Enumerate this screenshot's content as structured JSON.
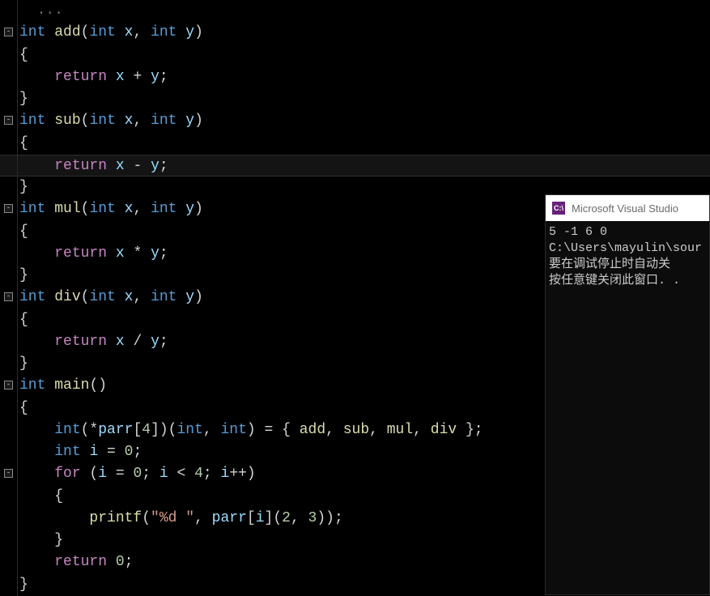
{
  "code_lines": [
    {
      "fold": "",
      "segs": [
        {
          "t": "dim",
          "v": "  ..."
        }
      ]
    },
    {
      "fold": "-",
      "segs": [
        {
          "t": "kw",
          "v": "int"
        },
        {
          "t": "pun",
          "v": " "
        },
        {
          "t": "fn",
          "v": "add"
        },
        {
          "t": "pun",
          "v": "("
        },
        {
          "t": "kw",
          "v": "int"
        },
        {
          "t": "pun",
          "v": " "
        },
        {
          "t": "var",
          "v": "x"
        },
        {
          "t": "pun",
          "v": ", "
        },
        {
          "t": "kw",
          "v": "int"
        },
        {
          "t": "pun",
          "v": " "
        },
        {
          "t": "var",
          "v": "y"
        },
        {
          "t": "pun",
          "v": ")"
        }
      ]
    },
    {
      "fold": "",
      "segs": [
        {
          "t": "pun",
          "v": "{"
        }
      ]
    },
    {
      "fold": "",
      "segs": [
        {
          "t": "pun",
          "v": "    "
        },
        {
          "t": "op",
          "v": "return"
        },
        {
          "t": "pun",
          "v": " "
        },
        {
          "t": "var",
          "v": "x"
        },
        {
          "t": "pun",
          "v": " + "
        },
        {
          "t": "var",
          "v": "y"
        },
        {
          "t": "pun",
          "v": ";"
        }
      ]
    },
    {
      "fold": "",
      "segs": [
        {
          "t": "pun",
          "v": "}"
        }
      ]
    },
    {
      "fold": "-",
      "segs": [
        {
          "t": "kw",
          "v": "int"
        },
        {
          "t": "pun",
          "v": " "
        },
        {
          "t": "fn",
          "v": "sub"
        },
        {
          "t": "pun",
          "v": "("
        },
        {
          "t": "kw",
          "v": "int"
        },
        {
          "t": "pun",
          "v": " "
        },
        {
          "t": "var",
          "v": "x"
        },
        {
          "t": "pun",
          "v": ", "
        },
        {
          "t": "kw",
          "v": "int"
        },
        {
          "t": "pun",
          "v": " "
        },
        {
          "t": "var",
          "v": "y"
        },
        {
          "t": "pun",
          "v": ")"
        }
      ]
    },
    {
      "fold": "",
      "segs": [
        {
          "t": "pun",
          "v": "{"
        }
      ]
    },
    {
      "fold": "",
      "highlight": true,
      "segs": [
        {
          "t": "pun",
          "v": "    "
        },
        {
          "t": "op",
          "v": "return"
        },
        {
          "t": "pun",
          "v": " "
        },
        {
          "t": "var",
          "v": "x"
        },
        {
          "t": "pun",
          "v": " - "
        },
        {
          "t": "var",
          "v": "y"
        },
        {
          "t": "pun",
          "v": ";"
        }
      ]
    },
    {
      "fold": "",
      "segs": [
        {
          "t": "pun",
          "v": "}"
        }
      ]
    },
    {
      "fold": "-",
      "segs": [
        {
          "t": "kw",
          "v": "int"
        },
        {
          "t": "pun",
          "v": " "
        },
        {
          "t": "fn",
          "v": "mul"
        },
        {
          "t": "pun",
          "v": "("
        },
        {
          "t": "kw",
          "v": "int"
        },
        {
          "t": "pun",
          "v": " "
        },
        {
          "t": "var",
          "v": "x"
        },
        {
          "t": "pun",
          "v": ", "
        },
        {
          "t": "kw",
          "v": "int"
        },
        {
          "t": "pun",
          "v": " "
        },
        {
          "t": "var",
          "v": "y"
        },
        {
          "t": "pun",
          "v": ")"
        }
      ]
    },
    {
      "fold": "",
      "segs": [
        {
          "t": "pun",
          "v": "{"
        }
      ]
    },
    {
      "fold": "",
      "segs": [
        {
          "t": "pun",
          "v": "    "
        },
        {
          "t": "op",
          "v": "return"
        },
        {
          "t": "pun",
          "v": " "
        },
        {
          "t": "var",
          "v": "x"
        },
        {
          "t": "pun",
          "v": " * "
        },
        {
          "t": "var",
          "v": "y"
        },
        {
          "t": "pun",
          "v": ";"
        }
      ]
    },
    {
      "fold": "",
      "segs": [
        {
          "t": "pun",
          "v": "}"
        }
      ]
    },
    {
      "fold": "-",
      "segs": [
        {
          "t": "kw",
          "v": "int"
        },
        {
          "t": "pun",
          "v": " "
        },
        {
          "t": "fn",
          "v": "div"
        },
        {
          "t": "pun",
          "v": "("
        },
        {
          "t": "kw",
          "v": "int"
        },
        {
          "t": "pun",
          "v": " "
        },
        {
          "t": "var",
          "v": "x"
        },
        {
          "t": "pun",
          "v": ", "
        },
        {
          "t": "kw",
          "v": "int"
        },
        {
          "t": "pun",
          "v": " "
        },
        {
          "t": "var",
          "v": "y"
        },
        {
          "t": "pun",
          "v": ")"
        }
      ]
    },
    {
      "fold": "",
      "segs": [
        {
          "t": "pun",
          "v": "{"
        }
      ]
    },
    {
      "fold": "",
      "segs": [
        {
          "t": "pun",
          "v": "    "
        },
        {
          "t": "op",
          "v": "return"
        },
        {
          "t": "pun",
          "v": " "
        },
        {
          "t": "var",
          "v": "x"
        },
        {
          "t": "pun",
          "v": " / "
        },
        {
          "t": "var",
          "v": "y"
        },
        {
          "t": "pun",
          "v": ";"
        }
      ]
    },
    {
      "fold": "",
      "segs": [
        {
          "t": "pun",
          "v": "}"
        }
      ]
    },
    {
      "fold": "-",
      "segs": [
        {
          "t": "kw",
          "v": "int"
        },
        {
          "t": "pun",
          "v": " "
        },
        {
          "t": "fn",
          "v": "main"
        },
        {
          "t": "pun",
          "v": "()"
        }
      ]
    },
    {
      "fold": "",
      "segs": [
        {
          "t": "pun",
          "v": "{"
        }
      ]
    },
    {
      "fold": "",
      "segs": [
        {
          "t": "pun",
          "v": "    "
        },
        {
          "t": "kw",
          "v": "int"
        },
        {
          "t": "pun",
          "v": "(*"
        },
        {
          "t": "var",
          "v": "parr"
        },
        {
          "t": "pun",
          "v": "["
        },
        {
          "t": "num",
          "v": "4"
        },
        {
          "t": "pun",
          "v": "])("
        },
        {
          "t": "kw",
          "v": "int"
        },
        {
          "t": "pun",
          "v": ", "
        },
        {
          "t": "kw",
          "v": "int"
        },
        {
          "t": "pun",
          "v": ") = { "
        },
        {
          "t": "fn",
          "v": "add"
        },
        {
          "t": "pun",
          "v": ", "
        },
        {
          "t": "fn",
          "v": "sub"
        },
        {
          "t": "pun",
          "v": ", "
        },
        {
          "t": "fn",
          "v": "mul"
        },
        {
          "t": "pun",
          "v": ", "
        },
        {
          "t": "fn",
          "v": "div"
        },
        {
          "t": "pun",
          "v": " };"
        }
      ]
    },
    {
      "fold": "",
      "segs": [
        {
          "t": "pun",
          "v": "    "
        },
        {
          "t": "kw",
          "v": "int"
        },
        {
          "t": "pun",
          "v": " "
        },
        {
          "t": "var",
          "v": "i"
        },
        {
          "t": "pun",
          "v": " = "
        },
        {
          "t": "num",
          "v": "0"
        },
        {
          "t": "pun",
          "v": ";"
        }
      ]
    },
    {
      "fold": "-",
      "segs": [
        {
          "t": "pun",
          "v": "    "
        },
        {
          "t": "op",
          "v": "for"
        },
        {
          "t": "pun",
          "v": " ("
        },
        {
          "t": "var",
          "v": "i"
        },
        {
          "t": "pun",
          "v": " = "
        },
        {
          "t": "num",
          "v": "0"
        },
        {
          "t": "pun",
          "v": "; "
        },
        {
          "t": "var",
          "v": "i"
        },
        {
          "t": "pun",
          "v": " < "
        },
        {
          "t": "num",
          "v": "4"
        },
        {
          "t": "pun",
          "v": "; "
        },
        {
          "t": "var",
          "v": "i"
        },
        {
          "t": "pun",
          "v": "++)"
        }
      ]
    },
    {
      "fold": "",
      "segs": [
        {
          "t": "pun",
          "v": "    {"
        }
      ]
    },
    {
      "fold": "",
      "segs": [
        {
          "t": "pun",
          "v": "        "
        },
        {
          "t": "fn",
          "v": "printf"
        },
        {
          "t": "pun",
          "v": "("
        },
        {
          "t": "str",
          "v": "\"%d \""
        },
        {
          "t": "pun",
          "v": ", "
        },
        {
          "t": "var",
          "v": "parr"
        },
        {
          "t": "pun",
          "v": "["
        },
        {
          "t": "var",
          "v": "i"
        },
        {
          "t": "pun",
          "v": "]("
        },
        {
          "t": "num",
          "v": "2"
        },
        {
          "t": "pun",
          "v": ", "
        },
        {
          "t": "num",
          "v": "3"
        },
        {
          "t": "pun",
          "v": "));"
        }
      ]
    },
    {
      "fold": "",
      "segs": [
        {
          "t": "pun",
          "v": "    }"
        }
      ]
    },
    {
      "fold": "",
      "segs": [
        {
          "t": "pun",
          "v": "    "
        },
        {
          "t": "op",
          "v": "return"
        },
        {
          "t": "pun",
          "v": " "
        },
        {
          "t": "num",
          "v": "0"
        },
        {
          "t": "pun",
          "v": ";"
        }
      ]
    },
    {
      "fold": "",
      "segs": [
        {
          "t": "pun",
          "v": "}"
        }
      ]
    }
  ],
  "console": {
    "icon_text": "C:\\",
    "title": "Microsoft Visual Studio",
    "lines": [
      "5 -1 6 0",
      "C:\\Users\\mayulin\\sour",
      "要在调试停止时自动关",
      "按任意键关闭此窗口. ."
    ]
  }
}
